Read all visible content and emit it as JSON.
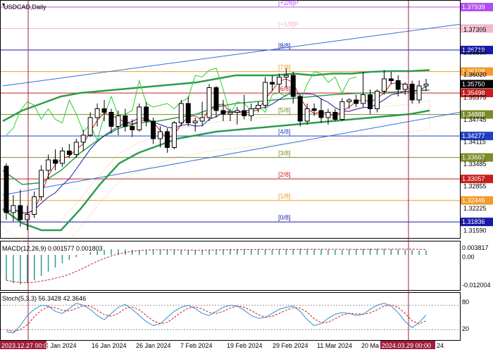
{
  "window": {
    "title": "USDCAD,Daily",
    "macd_label": "MACD(12,26,9) 0.001577 0.001803",
    "stoch_label": "Stoch(5,3,3) 56.3428 42.3646"
  },
  "murray_levels": [
    {
      "name": "[+2/8]P",
      "price": "1.37939",
      "value": 1.37939,
      "color": "#b04ff0"
    },
    {
      "name": "[+1/8]P",
      "price": "1.37329",
      "value": 1.37329,
      "color": "#f3b7c9"
    },
    {
      "name": "[8/8]",
      "price": "1.36719",
      "value": 1.36719,
      "color": "#1a1aa8"
    },
    {
      "name": "[7/8]",
      "price": "1.36108",
      "value": 1.36108,
      "color": "#f29a2a"
    },
    {
      "name": "[6/8]",
      "price": "1.35498",
      "value": 1.35498,
      "color": "#c81e1e"
    },
    {
      "name": "[5/8]",
      "price": "1.34888",
      "value": 1.34888,
      "color": "#7b8b2a"
    },
    {
      "name": "[4/8]",
      "price": "1.34277",
      "value": 1.34277,
      "color": "#1f3fbf"
    },
    {
      "name": "[3/8]",
      "price": "1.33667",
      "value": 1.33667,
      "color": "#7b8b2a"
    },
    {
      "name": "[2/8]",
      "price": "1.33057",
      "value": 1.33057,
      "color": "#c81e1e"
    },
    {
      "name": "[1/8]",
      "price": "1.32446",
      "value": 1.32446,
      "color": "#f29a2a"
    },
    {
      "name": "[0/8]",
      "price": "1.31836",
      "value": 1.31836,
      "color": "#1a1aa8"
    }
  ],
  "price_axis": {
    "ticks": [
      "1.37305",
      "1.36650",
      "1.36020",
      "1.35375",
      "1.34745",
      "1.34115",
      "1.33485",
      "1.32855",
      "1.32225",
      "1.31590"
    ],
    "tick_values": [
      1.37305,
      1.3665,
      1.3602,
      1.35375,
      1.34745,
      1.34115,
      1.33485,
      1.32855,
      1.32225,
      1.3159
    ],
    "current_price": "1.35750",
    "current_value": 1.3575
  },
  "macd_axis": {
    "ticks": [
      "0.003817",
      "0.00",
      "-0.012004"
    ]
  },
  "stoch_axis": {
    "ticks": [
      "80",
      "20"
    ]
  },
  "time_axis": {
    "start_label": "2023.12.27 00:00",
    "cursor_label": "2024.03.29 00:00",
    "labels": [
      "4 Jan 2024",
      "16 Jan 2024",
      "26 Jan 2024",
      "7 Feb 2024",
      "19 Feb 2024",
      "29 Feb 2024",
      "11 Mar 2024",
      "20 Ma",
      "24"
    ]
  },
  "chart_data": {
    "type": "candlestick",
    "symbol": "USDCAD",
    "timeframe": "Daily",
    "ylim": [
      1.314,
      1.381
    ],
    "candles": [
      [
        1.3342,
        1.335,
        1.319,
        1.321
      ],
      [
        1.321,
        1.326,
        1.3185,
        1.323
      ],
      [
        1.323,
        1.3275,
        1.317,
        1.319
      ],
      [
        1.319,
        1.323,
        1.316,
        1.3205
      ],
      [
        1.3205,
        1.327,
        1.3195,
        1.3255
      ],
      [
        1.3255,
        1.3345,
        1.3245,
        1.333
      ],
      [
        1.333,
        1.3375,
        1.3305,
        1.336
      ],
      [
        1.336,
        1.339,
        1.333,
        1.335
      ],
      [
        1.335,
        1.3395,
        1.334,
        1.3385
      ],
      [
        1.3385,
        1.3405,
        1.3365,
        1.3375
      ],
      [
        1.3375,
        1.342,
        1.3365,
        1.341
      ],
      [
        1.341,
        1.3445,
        1.3385,
        1.343
      ],
      [
        1.343,
        1.3495,
        1.3425,
        1.348
      ],
      [
        1.348,
        1.352,
        1.3455,
        1.3505
      ],
      [
        1.3505,
        1.353,
        1.347,
        1.3495
      ],
      [
        1.3495,
        1.3505,
        1.3435,
        1.3455
      ],
      [
        1.3455,
        1.35,
        1.343,
        1.3485
      ],
      [
        1.3485,
        1.3505,
        1.344,
        1.3455
      ],
      [
        1.3455,
        1.3475,
        1.3425,
        1.3445
      ],
      [
        1.3445,
        1.352,
        1.344,
        1.351
      ],
      [
        1.351,
        1.3525,
        1.3455,
        1.347
      ],
      [
        1.347,
        1.348,
        1.3405,
        1.342
      ],
      [
        1.342,
        1.3455,
        1.3395,
        1.344
      ],
      [
        1.344,
        1.345,
        1.338,
        1.3395
      ],
      [
        1.3395,
        1.347,
        1.339,
        1.3465
      ],
      [
        1.3465,
        1.353,
        1.3455,
        1.352
      ],
      [
        1.352,
        1.354,
        1.3455,
        1.3465
      ],
      [
        1.3465,
        1.348,
        1.344,
        1.347
      ],
      [
        1.347,
        1.3525,
        1.3455,
        1.348
      ],
      [
        1.348,
        1.3575,
        1.347,
        1.3565
      ],
      [
        1.3565,
        1.357,
        1.348,
        1.35
      ],
      [
        1.35,
        1.353,
        1.347,
        1.349
      ],
      [
        1.349,
        1.3505,
        1.347,
        1.3495
      ],
      [
        1.3495,
        1.351,
        1.346,
        1.35
      ],
      [
        1.35,
        1.3545,
        1.3475,
        1.3485
      ],
      [
        1.3485,
        1.352,
        1.347,
        1.3505
      ],
      [
        1.3505,
        1.3525,
        1.3495,
        1.3515
      ],
      [
        1.3515,
        1.3595,
        1.3505,
        1.358
      ],
      [
        1.358,
        1.36,
        1.3555,
        1.3575
      ],
      [
        1.3575,
        1.3605,
        1.355,
        1.3595
      ],
      [
        1.3595,
        1.362,
        1.3565,
        1.36
      ],
      [
        1.36,
        1.361,
        1.352,
        1.354
      ],
      [
        1.354,
        1.3545,
        1.3455,
        1.347
      ],
      [
        1.347,
        1.352,
        1.346,
        1.3505
      ],
      [
        1.3505,
        1.352,
        1.3485,
        1.35
      ],
      [
        1.35,
        1.3535,
        1.3465,
        1.348
      ],
      [
        1.348,
        1.3505,
        1.346,
        1.3495
      ],
      [
        1.3495,
        1.3505,
        1.347,
        1.3475
      ],
      [
        1.3475,
        1.3535,
        1.347,
        1.3525
      ],
      [
        1.3525,
        1.3535,
        1.3505,
        1.353
      ],
      [
        1.353,
        1.3545,
        1.351,
        1.352
      ],
      [
        1.352,
        1.361,
        1.351,
        1.3545
      ],
      [
        1.3545,
        1.356,
        1.349,
        1.3505
      ],
      [
        1.3505,
        1.356,
        1.3495,
        1.3555
      ],
      [
        1.3555,
        1.3615,
        1.3545,
        1.359
      ],
      [
        1.359,
        1.361,
        1.3575,
        1.3585
      ],
      [
        1.3585,
        1.36,
        1.354,
        1.356
      ],
      [
        1.356,
        1.358,
        1.3545,
        1.3575
      ],
      [
        1.3575,
        1.3585,
        1.352,
        1.353
      ],
      [
        1.353,
        1.3585,
        1.352,
        1.357
      ],
      [
        1.357,
        1.359,
        1.3555,
        1.3575
      ]
    ],
    "indicators": {
      "bollinger_upper": [
        1.347,
        1.35,
        1.352,
        1.354,
        1.355,
        1.3555,
        1.356,
        1.3565,
        1.357,
        1.3575,
        1.358,
        1.359,
        1.36,
        1.36,
        1.36,
        1.3605,
        1.36,
        1.3605,
        1.3605,
        1.361,
        1.3612,
        1.3612,
        1.3615
      ],
      "bollinger_middle": [
        1.333,
        1.329,
        1.3295,
        1.333,
        1.338,
        1.342,
        1.345,
        1.3465,
        1.347,
        1.348,
        1.349,
        1.351,
        1.352,
        1.3525,
        1.353,
        1.3535,
        1.354,
        1.3545,
        1.3548,
        1.355,
        1.3552,
        1.3555,
        1.3558
      ],
      "bollinger_lower": [
        1.322,
        1.318,
        1.316,
        1.316,
        1.322,
        1.329,
        1.335,
        1.338,
        1.34,
        1.342,
        1.343,
        1.344,
        1.3445,
        1.345,
        1.3455,
        1.346,
        1.3465,
        1.347,
        1.3475,
        1.348,
        1.3485,
        1.349,
        1.35
      ]
    },
    "trend_channel": {
      "upper_start": 1.357,
      "upper_end": 1.3745,
      "lower_start": 1.326,
      "lower_end": 1.3495
    },
    "macd_histogram": [
      -0.009,
      -0.01,
      -0.0105,
      -0.01,
      -0.009,
      -0.0075,
      -0.006,
      -0.0045,
      -0.003,
      -0.0018,
      -0.0008,
      0.0002,
      0.001,
      0.0015,
      0.0018,
      0.002,
      0.002,
      0.0019,
      0.0018,
      0.0017,
      0.0016,
      0.0016,
      0.0017,
      0.0018,
      0.0018,
      0.0017,
      0.0016,
      0.0016,
      0.0017,
      0.0018,
      0.0019,
      0.002,
      0.0021,
      0.0021,
      0.002,
      0.0019,
      0.0018,
      0.0018,
      0.0018,
      0.0019,
      0.002,
      0.0021,
      0.0022,
      0.0021,
      0.002,
      0.0019,
      0.0018,
      0.0018,
      0.0018,
      0.0019,
      0.002,
      0.0021,
      0.0022,
      0.0022,
      0.0021,
      0.002,
      0.0019,
      0.0018,
      0.0017,
      0.0016,
      0.0016
    ],
    "stoch_main": [
      15,
      12,
      30,
      55,
      70,
      80,
      78,
      65,
      60,
      72,
      85,
      80,
      70,
      55,
      45,
      60,
      75,
      82,
      70,
      55,
      40,
      30,
      35,
      50,
      65,
      75,
      80,
      72,
      60,
      55,
      65,
      75,
      80,
      78,
      68,
      55,
      48,
      50,
      60,
      70,
      75,
      78,
      65,
      45,
      30,
      35,
      48,
      58,
      62,
      60,
      55,
      58,
      70,
      80,
      85,
      78,
      62,
      40,
      25,
      38,
      56
    ],
    "stoch_signal": [
      20,
      16,
      20,
      32,
      52,
      68,
      76,
      74,
      68,
      66,
      72,
      79,
      78,
      68,
      57,
      53,
      60,
      72,
      76,
      69,
      55,
      42,
      35,
      38,
      50,
      63,
      73,
      76,
      71,
      62,
      60,
      65,
      73,
      78,
      75,
      67,
      57,
      51,
      53,
      60,
      68,
      74,
      73,
      63,
      47,
      37,
      38,
      47,
      56,
      60,
      59,
      58,
      61,
      69,
      78,
      81,
      75,
      60,
      42,
      34,
      42
    ]
  },
  "colors": {
    "bull_candle": "#ffffff",
    "bear_candle": "#000000",
    "bollinger": "#2e9c4f",
    "channel": "#2f6fd6",
    "cursor": "#a01e3c",
    "tenkan": "#c81e1e",
    "kijun": "#1a1aa8",
    "chikou": "#2bd12b",
    "cloud": "#f2a35b",
    "highlight_label": "#1a1aa8",
    "current_price_label": "#000000"
  }
}
